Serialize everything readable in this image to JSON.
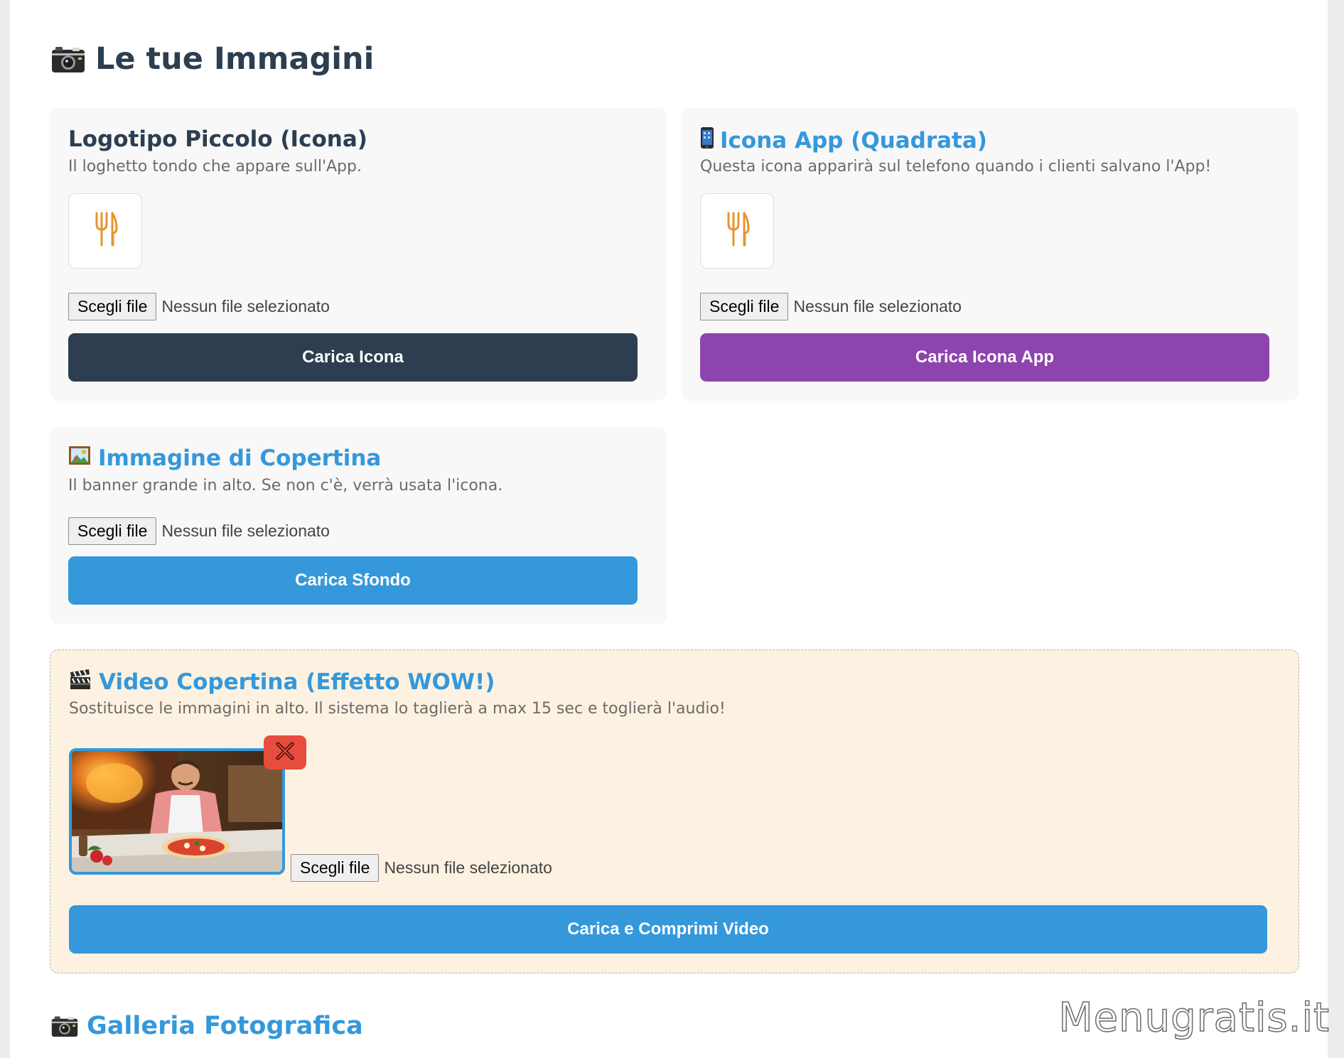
{
  "page": {
    "title": "Le tue Immagini",
    "gallery_title": "Galleria Fotografica",
    "watermark": "Menugratis.it"
  },
  "cards": {
    "logo": {
      "title": "Logotipo Piccolo (Icona)",
      "description": "Il loghetto tondo che appare sull'App.",
      "file_button": "Scegli file",
      "file_status": "Nessun file selezionato",
      "submit": "Carica Icona"
    },
    "app_icon": {
      "title": "Icona App (Quadrata)",
      "description": "Questa icona apparirà sul telefono quando i clienti salvano l'App!",
      "file_button": "Scegli file",
      "file_status": "Nessun file selezionato",
      "submit": "Carica Icona App"
    },
    "cover": {
      "title": "Immagine di Copertina",
      "description": "Il banner grande in alto. Se non c'è, verrà usata l'icona.",
      "file_button": "Scegli file",
      "file_status": "Nessun file selezionato",
      "submit": "Carica Sfondo"
    },
    "video": {
      "title": "Video Copertina (Effetto WOW!)",
      "description": "Sostituisce le immagini in alto. Il sistema lo taglierà a max 15 sec e toglierà l'audio!",
      "file_button": "Scegli file",
      "file_status": "Nessun file selezionato",
      "submit": "Carica e Comprimi Video"
    }
  },
  "colors": {
    "dark": "#2c3e50",
    "purple": "#8e44ad",
    "blue": "#3498db",
    "red": "#e74c3c",
    "fork_icon": "#e8932f"
  },
  "icons": [
    "camera-icon",
    "mobile-phone-icon",
    "picture-icon",
    "clapper-board-icon",
    "fork-knife-icon",
    "close-icon"
  ]
}
